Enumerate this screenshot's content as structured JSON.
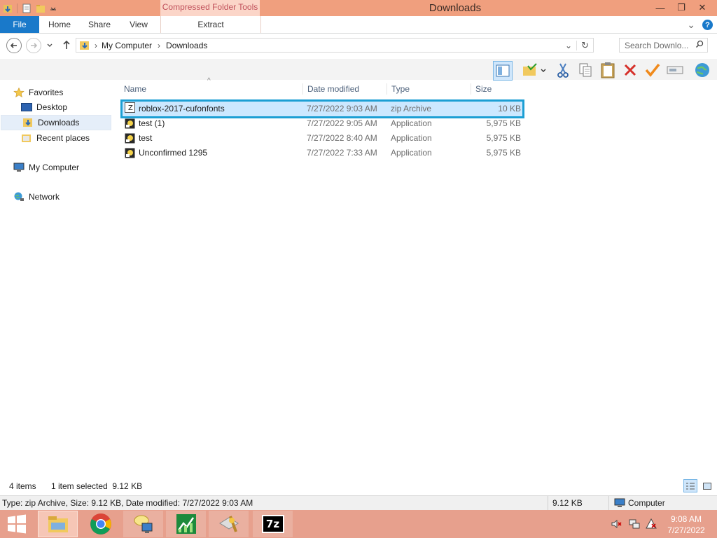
{
  "window": {
    "title": "Downloads",
    "contextual_tab_group": "Compressed Folder Tools",
    "minimize_glyph": "—",
    "maximize_glyph": "❐",
    "close_glyph": "✕"
  },
  "ribbon": {
    "tabs": [
      "File",
      "Home",
      "Share",
      "View",
      "Extract"
    ],
    "expand_glyph": "⌄",
    "help_glyph": "?"
  },
  "address_bar": {
    "breadcrumbs": [
      "My Computer",
      "Downloads"
    ],
    "separator": "›",
    "search_placeholder": "Search Downlo...",
    "dropdown_glyph": "⌄",
    "refresh_glyph": "↻"
  },
  "nav_pane": {
    "favorites": {
      "label": "Favorites",
      "icon": "star-icon"
    },
    "favorite_items": [
      {
        "label": "Desktop",
        "icon": "desktop-icon"
      },
      {
        "label": "Downloads",
        "icon": "downloads-folder-icon",
        "selected": true
      },
      {
        "label": "Recent places",
        "icon": "recent-places-icon"
      }
    ],
    "computer": {
      "label": "My Computer",
      "icon": "computer-icon"
    },
    "network": {
      "label": "Network",
      "icon": "network-icon"
    }
  },
  "file_list": {
    "columns": [
      "Name",
      "Date modified",
      "Type",
      "Size"
    ],
    "sort_glyph": "^",
    "rows": [
      {
        "name": "roblox-2017-cufonfonts",
        "date": "7/27/2022 9:03 AM",
        "type": "zip Archive",
        "size": "10 KB",
        "icon": "zip-archive-icon",
        "selected": true
      },
      {
        "name": "test (1)",
        "date": "7/27/2022 9:05 AM",
        "type": "Application",
        "size": "5,975 KB",
        "icon": "application-icon",
        "selected": false
      },
      {
        "name": "test",
        "date": "7/27/2022 8:40 AM",
        "type": "Application",
        "size": "5,975 KB",
        "icon": "application-icon",
        "selected": false
      },
      {
        "name": "Unconfirmed 1295",
        "date": "7/27/2022 7:33 AM",
        "type": "Application",
        "size": "5,975 KB",
        "icon": "application-icon",
        "selected": false
      }
    ]
  },
  "status": {
    "item_count": "4 items",
    "selection": "1 item selected  9.12 KB"
  },
  "details_bar": {
    "text": "Type: zip Archive, Size: 9.12 KB, Date modified: 7/27/2022 9:03 AM",
    "size": "9.12 KB",
    "location": "Computer"
  },
  "taskbar": {
    "clock_time": "9:08 AM",
    "clock_date": "7/27/2022",
    "apps": [
      "file-explorer-icon",
      "chrome-icon",
      "network-connections-icon",
      "task-manager-icon",
      "winzip-icon",
      "7zip-icon"
    ],
    "sevenzip_label": "7z"
  },
  "colors": {
    "titlebar": "#f09f7e",
    "accent": "#1979ca",
    "selection_border": "#1c9fd4",
    "taskbar": "#e7a08d"
  }
}
